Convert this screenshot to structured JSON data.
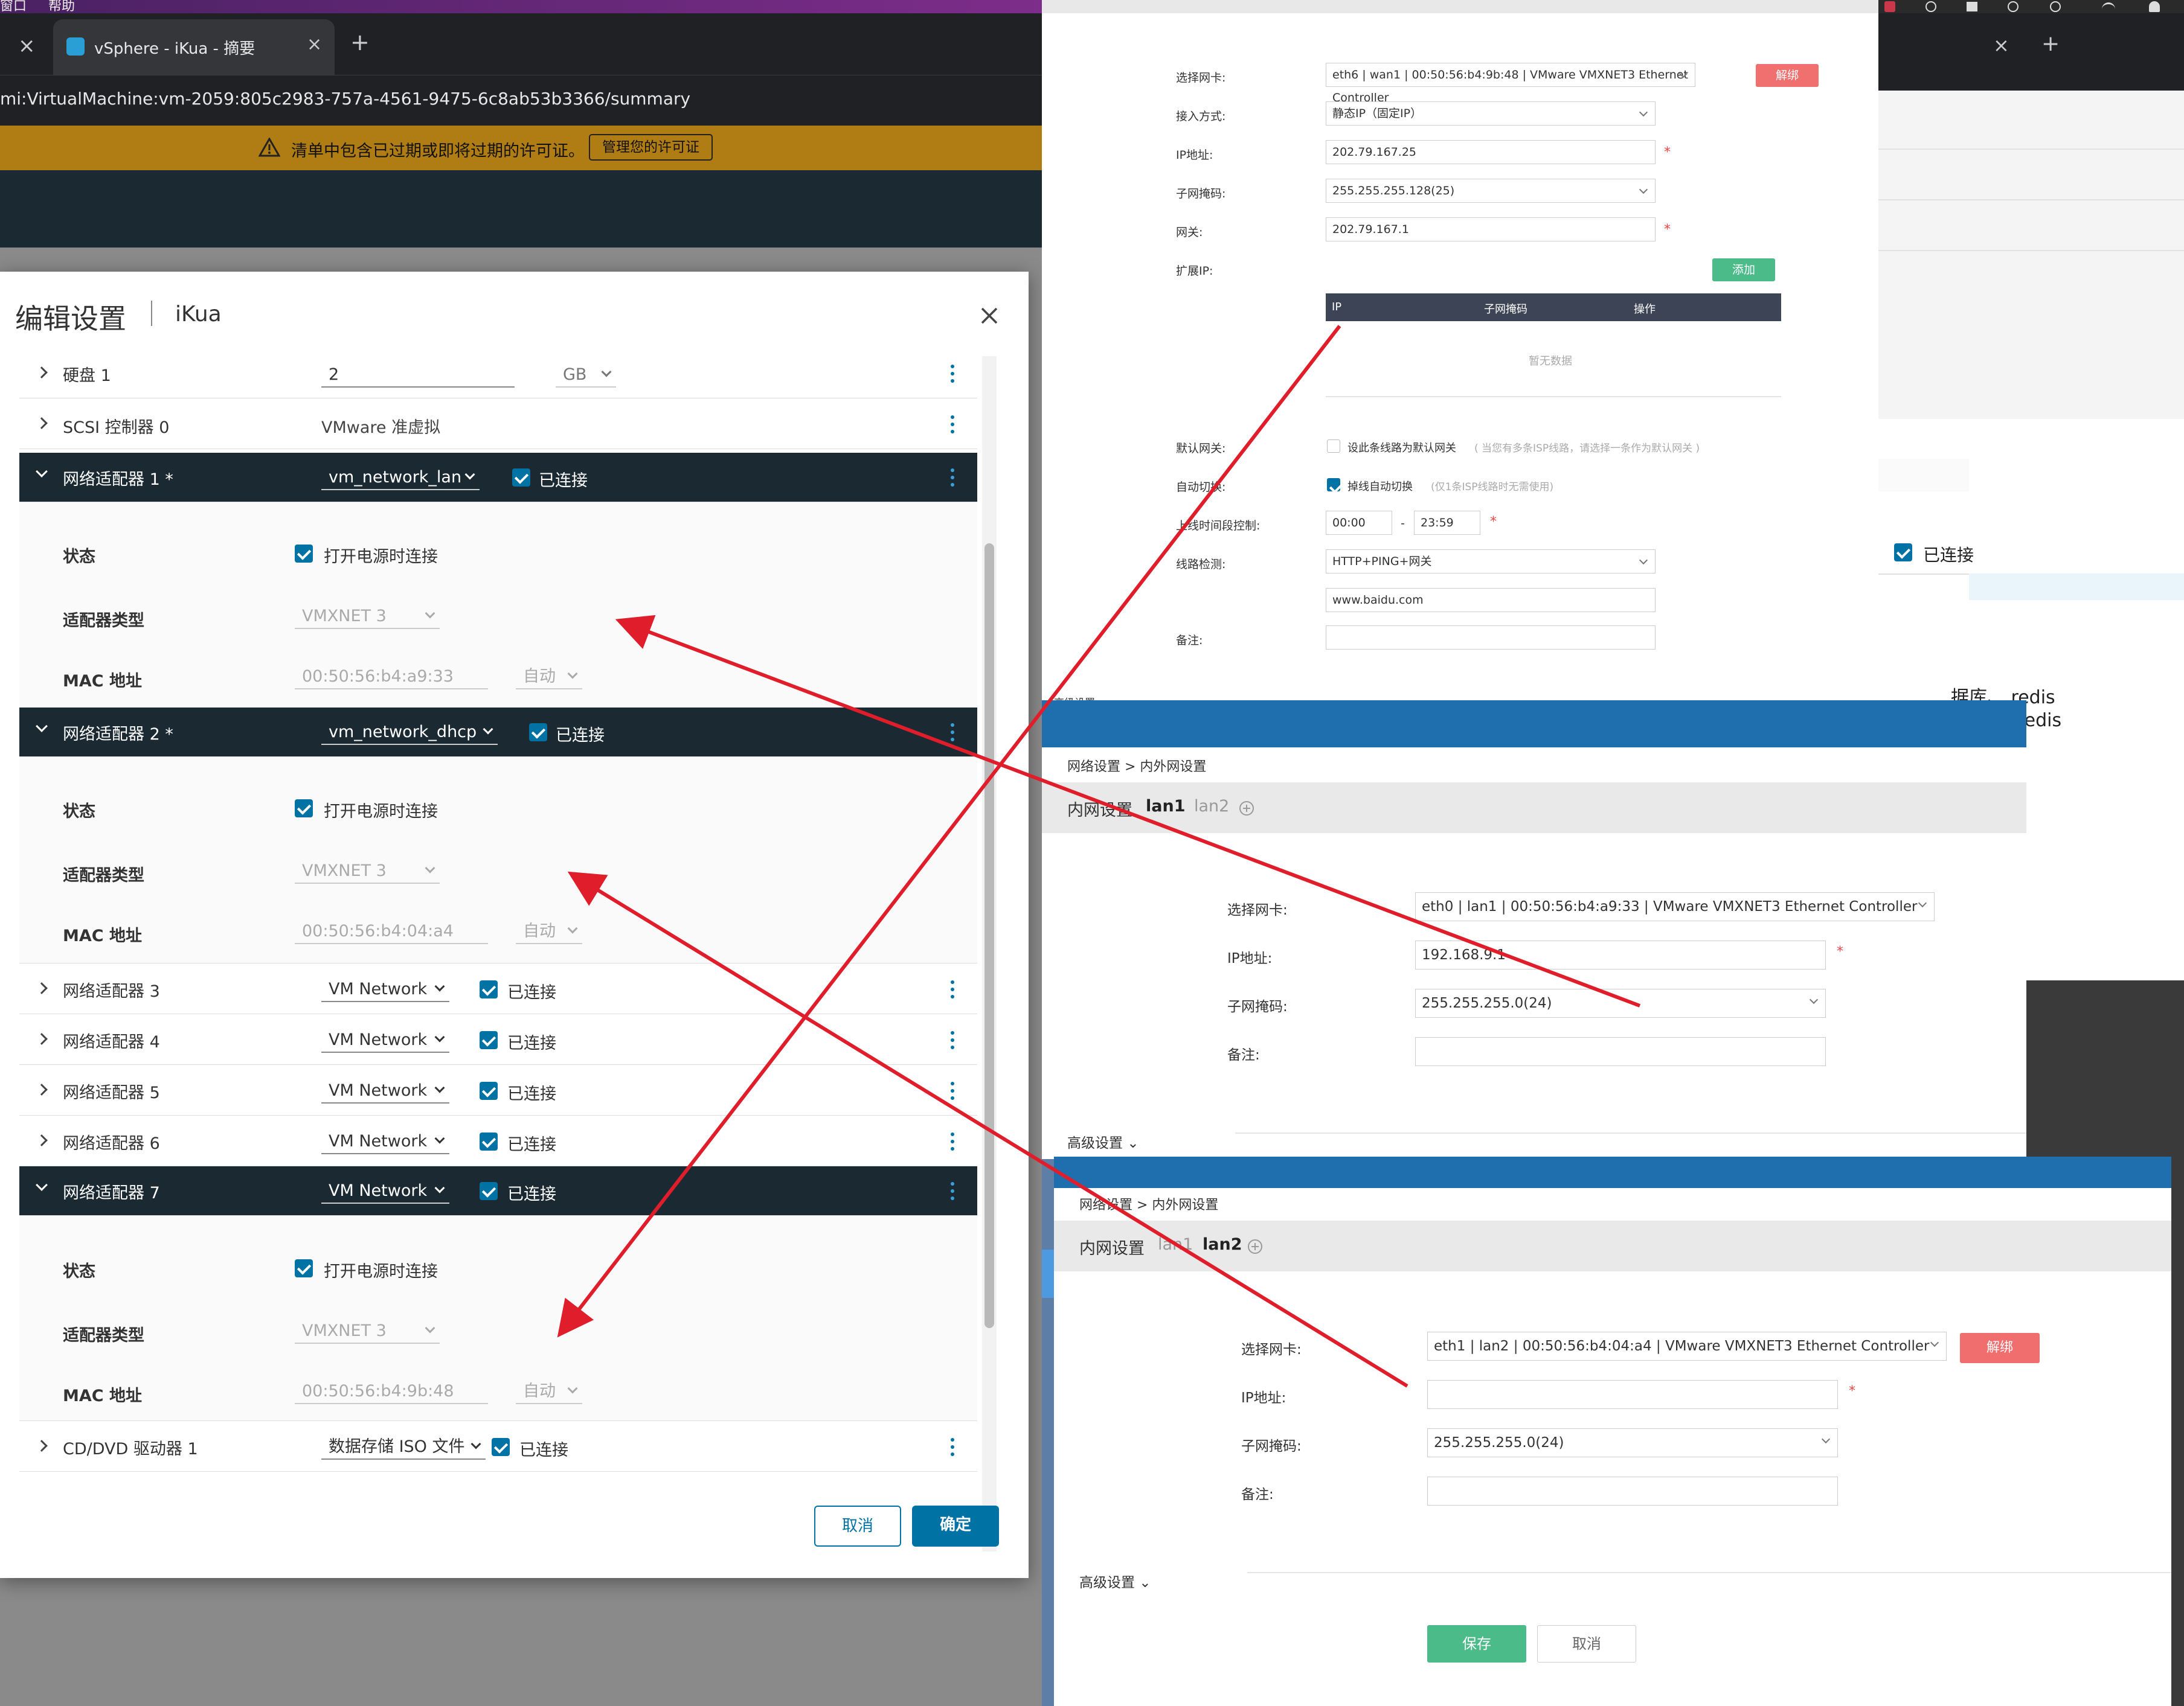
{
  "menubar": {
    "items": [
      "窗口",
      "帮助"
    ]
  },
  "browser": {
    "tab_title": "vSphere - iKua - 摘要",
    "tab_close": "×",
    "new_tab": "+",
    "url": "mi:VirtualMachine:vm-2059:805c2983-757a-4561-9475-6c8ab53b3366/summary",
    "right_tab_close": "×",
    "right_new_tab": "+"
  },
  "banner": {
    "text": "清单中包含已过期或即将过期的许可证。",
    "button": "管理您的许可证"
  },
  "modal": {
    "title": "编辑设置",
    "subtitle": "iKua",
    "rows": {
      "disk": {
        "label": "硬盘 1",
        "value": "2",
        "unit": "GB"
      },
      "scsi": {
        "label": "SCSI 控制器 0",
        "value": "VMware 准虚拟"
      },
      "net1": {
        "label": "网络适配器 1 *",
        "network": "vm_network_lan",
        "connected": "已连接"
      },
      "net1_state": {
        "label": "状态",
        "value": "打开电源时连接"
      },
      "net1_type": {
        "label": "适配器类型",
        "value": "VMXNET 3"
      },
      "net1_mac": {
        "label": "MAC 地址",
        "value": "00:50:56:b4:a9:33",
        "mode": "自动"
      },
      "net2": {
        "label": "网络适配器 2 *",
        "network": "vm_network_dhcp",
        "connected": "已连接"
      },
      "net2_state": {
        "label": "状态",
        "value": "打开电源时连接"
      },
      "net2_type": {
        "label": "适配器类型",
        "value": "VMXNET 3"
      },
      "net2_mac": {
        "label": "MAC 地址",
        "value": "00:50:56:b4:04:a4",
        "mode": "自动"
      },
      "net3": {
        "label": "网络适配器 3",
        "network": "VM Network",
        "connected": "已连接"
      },
      "net4": {
        "label": "网络适配器 4",
        "network": "VM Network",
        "connected": "已连接"
      },
      "net5": {
        "label": "网络适配器 5",
        "network": "VM Network",
        "connected": "已连接"
      },
      "net6": {
        "label": "网络适配器 6",
        "network": "VM Network",
        "connected": "已连接"
      },
      "net7": {
        "label": "网络适配器 7",
        "network": "VM Network",
        "connected": "已连接"
      },
      "net7_state": {
        "label": "状态",
        "value": "打开电源时连接"
      },
      "net7_type": {
        "label": "适配器类型",
        "value": "VMXNET 3"
      },
      "net7_mac": {
        "label": "MAC 地址",
        "value": "00:50:56:b4:9b:48",
        "mode": "自动"
      },
      "cd": {
        "label": "CD/DVD 驱动器 1",
        "value": "数据存储 ISO 文件",
        "connected": "已连接"
      }
    },
    "cancel": "取消",
    "ok": "确定"
  },
  "wan": {
    "nic_label": "选择网卡:",
    "nic_value": "eth6 | wan1 | 00:50:56:b4:9b:48 | VMware VMXNET3 Ethernet Controller",
    "unbind": "解绑",
    "mode_label": "接入方式:",
    "mode_value": "静态IP（固定IP）",
    "ip_label": "IP地址:",
    "ip_value": "202.79.167.25",
    "mask_label": "子网掩码:",
    "mask_value": "255.255.255.128(25)",
    "gw_label": "网关:",
    "gw_value": "202.79.167.1",
    "ext_label": "扩展IP:",
    "add": "添加",
    "th_ip": "IP",
    "th_mask": "子网掩码",
    "th_op": "操作",
    "empty": "暂无数据",
    "defgw_label": "默认网关:",
    "defgw_text": "设此条线路为默认网关",
    "defgw_hint": "( 当您有多条ISP线路，请选择一条作为默认网关 )",
    "auto_label": "自动切换:",
    "auto_text": "掉线自动切换",
    "auto_hint": "(仅1条ISP线路时无需使用)",
    "time_label": "上线时间段控制:",
    "time_from": "00:00",
    "time_sep": "-",
    "time_to": "23:59",
    "detect_label": "线路检测:",
    "detect_value": "HTTP+PING+网关",
    "detect_host": "www.baidu.com",
    "note_label": "备注:",
    "adv_fragment": "高级设置"
  },
  "right_side": {
    "check_text": "已连接",
    "line1": "据库、 redis",
    "line2": "redis"
  },
  "lan1": {
    "breadcrumb": "网络设置 > 内外网设置",
    "section": "内网设置",
    "tab_active": "lan1",
    "tab_other": "lan2",
    "nic_label": "选择网卡:",
    "nic_value": "eth0 | lan1 | 00:50:56:b4:a9:33 | VMware VMXNET3 Ethernet Controller",
    "ip_label": "IP地址:",
    "ip_value": "192.168.9.1",
    "mask_label": "子网掩码:",
    "mask_value": "255.255.255.0(24)",
    "note_label": "备注:",
    "adv": "高级设置"
  },
  "lan2": {
    "breadcrumb": "网络设置 > 内外网设置",
    "section": "内网设置",
    "tab_other": "lan1",
    "tab_active": "lan2",
    "nic_label": "选择网卡:",
    "nic_value": "eth1 | lan2 | 00:50:56:b4:04:a4 | VMware VMXNET3 Ethernet Controller",
    "unbind": "解绑",
    "ip_label": "IP地址:",
    "ip_value": "",
    "mask_label": "子网掩码:",
    "mask_value": "255.255.255.0(24)",
    "note_label": "备注:",
    "adv": "高级设置",
    "save": "保存",
    "cancel": "取消"
  },
  "colors": {
    "accent": "#0072a3",
    "vmware_dark": "#1b2a32",
    "router_blue": "#1f6faf",
    "save_green": "#4cbb8a",
    "unbind_red": "#f06e6e",
    "arrow_red": "#e01e2b"
  }
}
